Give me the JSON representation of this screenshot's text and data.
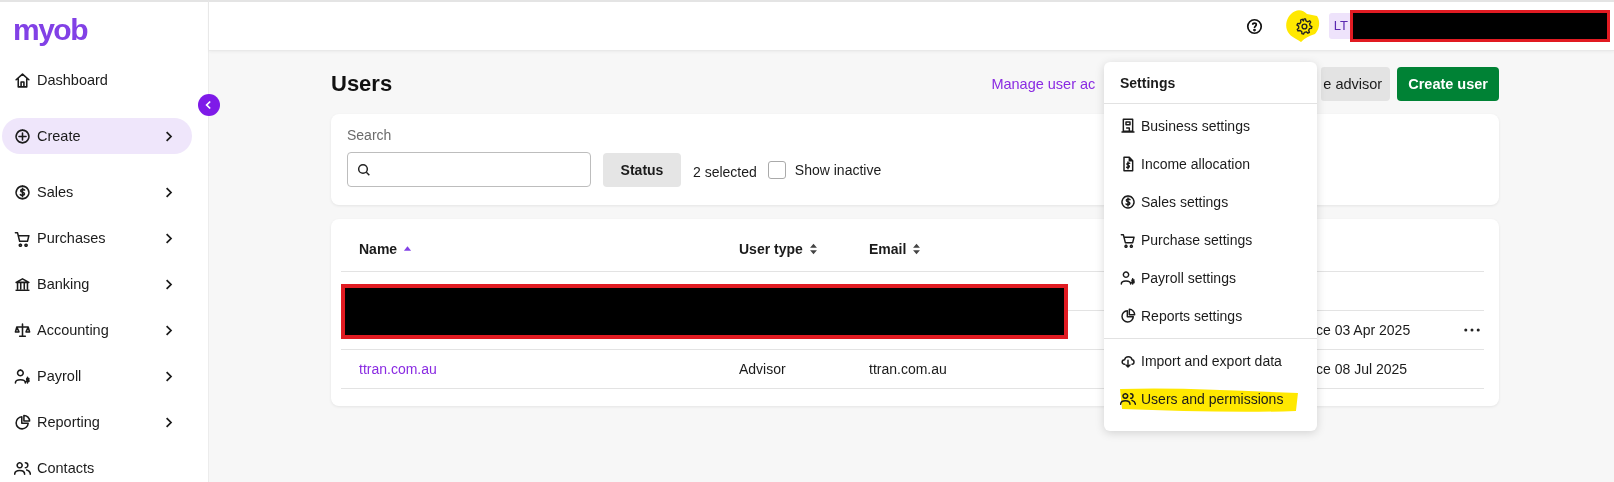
{
  "logo": "myob",
  "sidebar": {
    "items": [
      {
        "label": "Dashboard",
        "submenu": false,
        "selected": false
      },
      {
        "label": "Create",
        "submenu": true,
        "selected": true
      },
      {
        "label": "Sales",
        "submenu": true,
        "selected": false
      },
      {
        "label": "Purchases",
        "submenu": true,
        "selected": false
      },
      {
        "label": "Banking",
        "submenu": true,
        "selected": false
      },
      {
        "label": "Accounting",
        "submenu": true,
        "selected": false
      },
      {
        "label": "Payroll",
        "submenu": true,
        "selected": false
      },
      {
        "label": "Reporting",
        "submenu": true,
        "selected": false
      },
      {
        "label": "Contacts",
        "submenu": false,
        "selected": false
      }
    ]
  },
  "header": {
    "settings_highlighted": true,
    "user_initials": "LT",
    "user_redacted": true
  },
  "page": {
    "title": "Users",
    "link": "Manage user ac",
    "secondary_button": "e advisor",
    "primary_button": "Create user"
  },
  "filters": {
    "search_label": "Search",
    "status_button": "Status",
    "status_count": "2 selected",
    "show_inactive": {
      "label": "Show inactive",
      "checked": false
    }
  },
  "table": {
    "columns": [
      {
        "label": "Name",
        "sorted": true
      },
      {
        "label": "User type",
        "sorted": false
      },
      {
        "label": "Email",
        "sorted": false
      }
    ],
    "rows": [
      {
        "redacted": true
      },
      {
        "redacted": true,
        "status": "ce 03 Apr 2025",
        "actions": true
      },
      {
        "redacted": false,
        "name": "ttran.com.au",
        "user_type": "Advisor",
        "email": "ttran.com.au",
        "status": "ce 08 Jul 2025",
        "actions": false
      }
    ]
  },
  "settings_menu": {
    "title": "Settings",
    "groups": [
      [
        {
          "label": "Business settings",
          "highlighted": false
        },
        {
          "label": "Income allocation",
          "highlighted": false
        },
        {
          "label": "Sales settings",
          "highlighted": false
        },
        {
          "label": "Purchase settings",
          "highlighted": false
        },
        {
          "label": "Payroll settings",
          "highlighted": false
        },
        {
          "label": "Reports settings",
          "highlighted": false
        }
      ],
      [
        {
          "label": "Import and export data",
          "highlighted": false
        },
        {
          "label": "Users and permissions",
          "highlighted": true
        }
      ]
    ]
  }
}
